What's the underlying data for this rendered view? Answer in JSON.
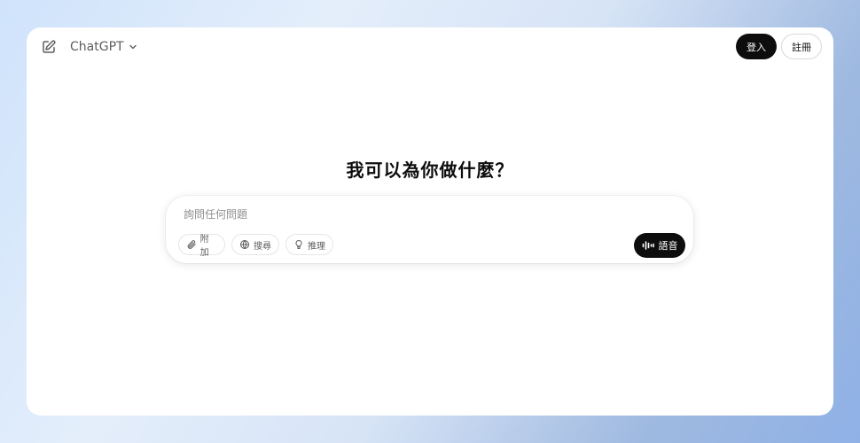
{
  "header": {
    "model_name": "ChatGPT",
    "login_label": "登入",
    "signup_label": "註冊"
  },
  "main": {
    "heading": "我可以為你做什麼？"
  },
  "composer": {
    "placeholder": "詢問任何問題",
    "tools": {
      "attach_label": "附加",
      "search_label": "搜尋",
      "reason_label": "推理"
    },
    "voice_label": "語音"
  },
  "colors": {
    "primary_button": "#0d0d0d",
    "page_background_start": "#cfe3fb",
    "page_background_end": "#8fb1e6"
  },
  "icons": [
    "new-chat-icon",
    "chevron-down-icon",
    "paperclip-icon",
    "globe-icon",
    "lightbulb-icon",
    "voice-wave-icon"
  ]
}
